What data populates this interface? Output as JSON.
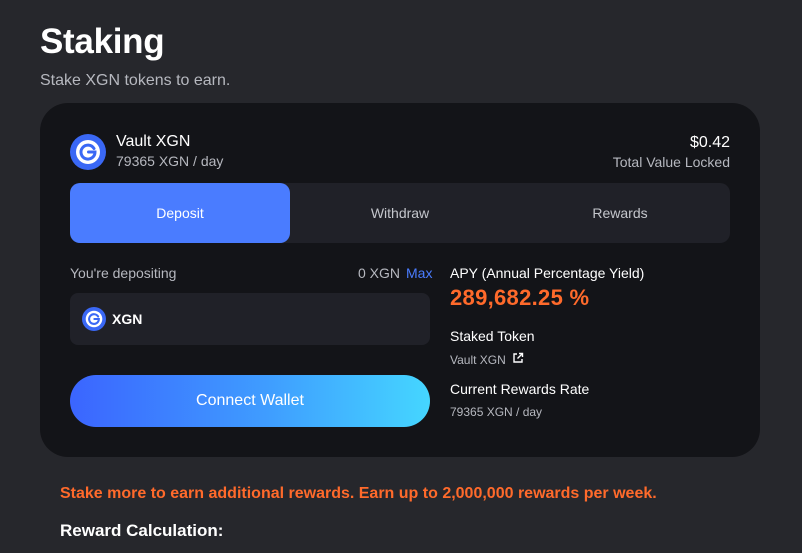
{
  "header": {
    "title": "Staking",
    "subtitle": "Stake XGN tokens to earn."
  },
  "vault": {
    "name": "Vault XGN",
    "rate": "79365 XGN / day",
    "tvl_value": "$0.42",
    "tvl_label": "Total Value Locked"
  },
  "tabs": [
    {
      "label": "Deposit",
      "active": true
    },
    {
      "label": "Withdraw",
      "active": false
    },
    {
      "label": "Rewards",
      "active": false
    }
  ],
  "deposit": {
    "label": "You're depositing",
    "balance": "0 XGN",
    "max_label": "Max",
    "token_symbol": "XGN",
    "connect_label": "Connect Wallet"
  },
  "info": {
    "apy_label": "APY (Annual Percentage Yield)",
    "apy_value": "289,682.25 %",
    "staked_label": "Staked Token",
    "staked_value": "Vault XGN",
    "rate_label": "Current Rewards Rate",
    "rate_value": "79365 XGN / day"
  },
  "footer": {
    "promo": "Stake more to earn additional rewards. Earn up to 2,000,000 rewards per week.",
    "reward_calc": "Reward Calculation:"
  },
  "icons": {
    "token_logo": "xgn-logo-icon",
    "external_link": "external-link-icon"
  },
  "colors": {
    "accent": "#4a7cff",
    "highlight": "#ff6a2b",
    "card_bg": "#131418",
    "page_bg": "#26272c"
  }
}
